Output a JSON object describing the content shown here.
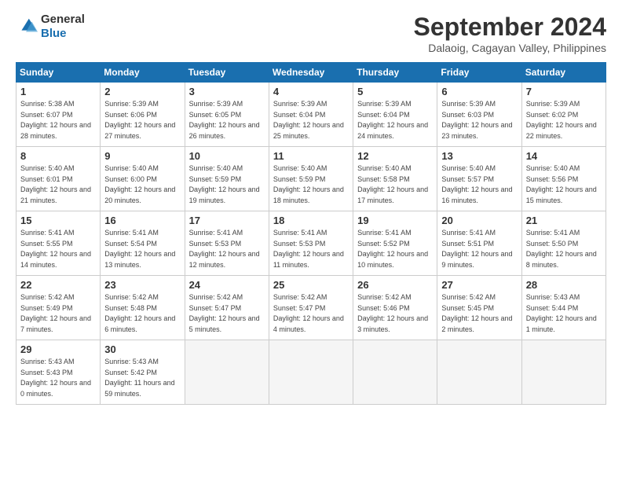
{
  "header": {
    "logo_line1": "General",
    "logo_line2": "Blue",
    "month_title": "September 2024",
    "subtitle": "Dalaoig, Cagayan Valley, Philippines"
  },
  "days_of_week": [
    "Sunday",
    "Monday",
    "Tuesday",
    "Wednesday",
    "Thursday",
    "Friday",
    "Saturday"
  ],
  "weeks": [
    [
      {
        "day": "1",
        "sunrise": "5:38 AM",
        "sunset": "6:07 PM",
        "daylight": "12 hours and 28 minutes."
      },
      {
        "day": "2",
        "sunrise": "5:39 AM",
        "sunset": "6:06 PM",
        "daylight": "12 hours and 27 minutes."
      },
      {
        "day": "3",
        "sunrise": "5:39 AM",
        "sunset": "6:05 PM",
        "daylight": "12 hours and 26 minutes."
      },
      {
        "day": "4",
        "sunrise": "5:39 AM",
        "sunset": "6:04 PM",
        "daylight": "12 hours and 25 minutes."
      },
      {
        "day": "5",
        "sunrise": "5:39 AM",
        "sunset": "6:04 PM",
        "daylight": "12 hours and 24 minutes."
      },
      {
        "day": "6",
        "sunrise": "5:39 AM",
        "sunset": "6:03 PM",
        "daylight": "12 hours and 23 minutes."
      },
      {
        "day": "7",
        "sunrise": "5:39 AM",
        "sunset": "6:02 PM",
        "daylight": "12 hours and 22 minutes."
      }
    ],
    [
      {
        "day": "8",
        "sunrise": "5:40 AM",
        "sunset": "6:01 PM",
        "daylight": "12 hours and 21 minutes."
      },
      {
        "day": "9",
        "sunrise": "5:40 AM",
        "sunset": "6:00 PM",
        "daylight": "12 hours and 20 minutes."
      },
      {
        "day": "10",
        "sunrise": "5:40 AM",
        "sunset": "5:59 PM",
        "daylight": "12 hours and 19 minutes."
      },
      {
        "day": "11",
        "sunrise": "5:40 AM",
        "sunset": "5:59 PM",
        "daylight": "12 hours and 18 minutes."
      },
      {
        "day": "12",
        "sunrise": "5:40 AM",
        "sunset": "5:58 PM",
        "daylight": "12 hours and 17 minutes."
      },
      {
        "day": "13",
        "sunrise": "5:40 AM",
        "sunset": "5:57 PM",
        "daylight": "12 hours and 16 minutes."
      },
      {
        "day": "14",
        "sunrise": "5:40 AM",
        "sunset": "5:56 PM",
        "daylight": "12 hours and 15 minutes."
      }
    ],
    [
      {
        "day": "15",
        "sunrise": "5:41 AM",
        "sunset": "5:55 PM",
        "daylight": "12 hours and 14 minutes."
      },
      {
        "day": "16",
        "sunrise": "5:41 AM",
        "sunset": "5:54 PM",
        "daylight": "12 hours and 13 minutes."
      },
      {
        "day": "17",
        "sunrise": "5:41 AM",
        "sunset": "5:53 PM",
        "daylight": "12 hours and 12 minutes."
      },
      {
        "day": "18",
        "sunrise": "5:41 AM",
        "sunset": "5:53 PM",
        "daylight": "12 hours and 11 minutes."
      },
      {
        "day": "19",
        "sunrise": "5:41 AM",
        "sunset": "5:52 PM",
        "daylight": "12 hours and 10 minutes."
      },
      {
        "day": "20",
        "sunrise": "5:41 AM",
        "sunset": "5:51 PM",
        "daylight": "12 hours and 9 minutes."
      },
      {
        "day": "21",
        "sunrise": "5:41 AM",
        "sunset": "5:50 PM",
        "daylight": "12 hours and 8 minutes."
      }
    ],
    [
      {
        "day": "22",
        "sunrise": "5:42 AM",
        "sunset": "5:49 PM",
        "daylight": "12 hours and 7 minutes."
      },
      {
        "day": "23",
        "sunrise": "5:42 AM",
        "sunset": "5:48 PM",
        "daylight": "12 hours and 6 minutes."
      },
      {
        "day": "24",
        "sunrise": "5:42 AM",
        "sunset": "5:47 PM",
        "daylight": "12 hours and 5 minutes."
      },
      {
        "day": "25",
        "sunrise": "5:42 AM",
        "sunset": "5:47 PM",
        "daylight": "12 hours and 4 minutes."
      },
      {
        "day": "26",
        "sunrise": "5:42 AM",
        "sunset": "5:46 PM",
        "daylight": "12 hours and 3 minutes."
      },
      {
        "day": "27",
        "sunrise": "5:42 AM",
        "sunset": "5:45 PM",
        "daylight": "12 hours and 2 minutes."
      },
      {
        "day": "28",
        "sunrise": "5:43 AM",
        "sunset": "5:44 PM",
        "daylight": "12 hours and 1 minute."
      }
    ],
    [
      {
        "day": "29",
        "sunrise": "5:43 AM",
        "sunset": "5:43 PM",
        "daylight": "12 hours and 0 minutes."
      },
      {
        "day": "30",
        "sunrise": "5:43 AM",
        "sunset": "5:42 PM",
        "daylight": "11 hours and 59 minutes."
      },
      null,
      null,
      null,
      null,
      null
    ]
  ]
}
